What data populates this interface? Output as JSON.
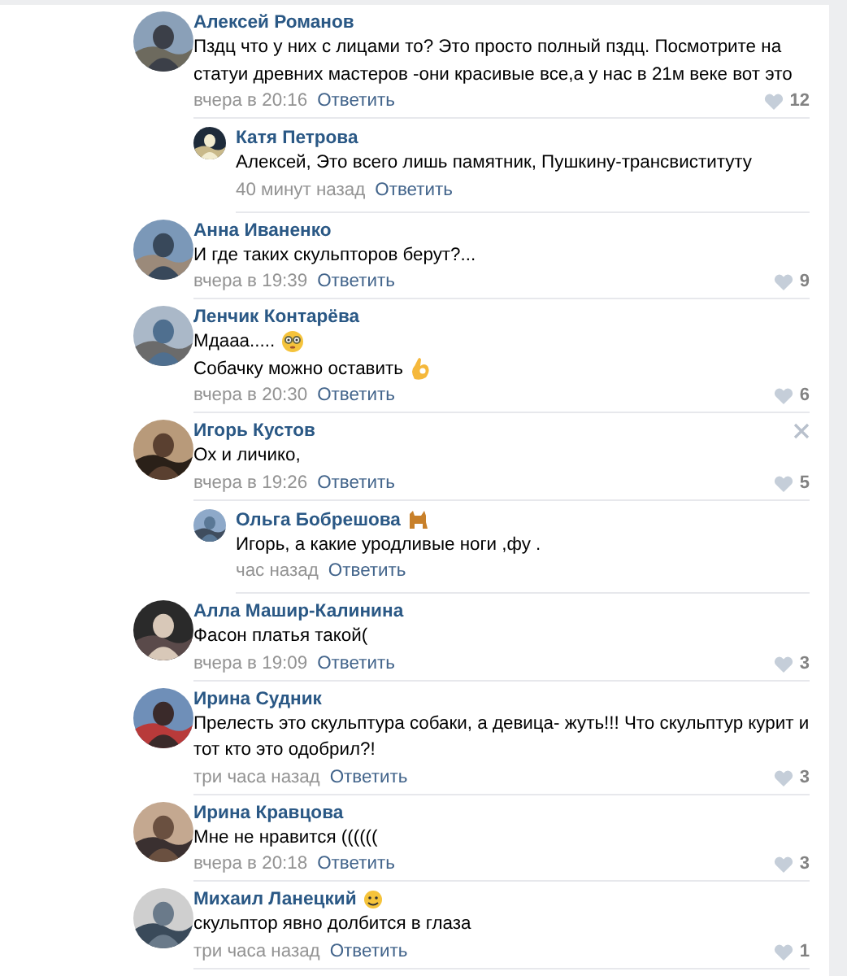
{
  "comments": [
    {
      "author": "Алексей Романов",
      "lines": [
        {
          "text": "Пздц что у них с лицами то? Это просто полный пздц. Посмотрите на статуи древних мастеров -они красивые все,а у нас в 21м веке вот это"
        }
      ],
      "time": "вчера в 20:16",
      "reply_label": "Ответить",
      "likes": "12",
      "close_visible": false,
      "replies": [
        {
          "author": "Катя Петрова",
          "lines": [
            {
              "text": "Алексей, Это всего лишь памятник, Пушкину-трансвиституту"
            }
          ],
          "time": "40 минут назад",
          "reply_label": "Ответить"
        }
      ]
    },
    {
      "author": "Анна Иваненко",
      "lines": [
        {
          "text": "И где таких скульпторов берут?..."
        }
      ],
      "time": "вчера в 19:39",
      "reply_label": "Ответить",
      "likes": "9",
      "close_visible": false
    },
    {
      "author": "Ленчик Контарёва",
      "lines": [
        {
          "text": "Мдааа.....",
          "kind": "flushed"
        },
        {
          "text": "Собачку можно оставить",
          "kind": "okhand"
        }
      ],
      "time": "вчера в 20:30",
      "reply_label": "Ответить",
      "likes": "6",
      "close_visible": false
    },
    {
      "author": "Игорь Кустов",
      "lines": [
        {
          "text": "Ох и личико,"
        }
      ],
      "time": "вчера в 19:26",
      "reply_label": "Ответить",
      "likes": "5",
      "close_visible": true,
      "replies": [
        {
          "author": "Ольга Бобрешова",
          "kind": "dog",
          "lines": [
            {
              "text": "Игорь, а какие уродливые ноги ,фу ."
            }
          ],
          "time": "час назад",
          "reply_label": "Ответить"
        }
      ]
    },
    {
      "author": "Алла Машир-Калинина",
      "lines": [
        {
          "text": "Фасон платья такой("
        }
      ],
      "time": "вчера в 19:09",
      "reply_label": "Ответить",
      "likes": "3",
      "close_visible": false
    },
    {
      "author": "Ирина Судник",
      "lines": [
        {
          "text": "Прелесть это скульптура собаки, а девица- жуть!!! Что скульптур курит и тот кто это одобрил?!"
        }
      ],
      "time": "три часа назад",
      "reply_label": "Ответить",
      "likes": "3",
      "close_visible": false
    },
    {
      "author": "Ирина Кравцова",
      "lines": [
        {
          "text": "Мне не нравится (((((("
        }
      ],
      "time": "вчера в 20:18",
      "reply_label": "Ответить",
      "likes": "3",
      "close_visible": false
    },
    {
      "author": "Михаил Ланецкий",
      "kind": "smiley",
      "lines": [
        {
          "text": "скульптор явно долбится в глаза"
        }
      ],
      "time": "три часа назад",
      "reply_label": "Ответить",
      "likes": "1",
      "close_visible": false
    }
  ]
}
